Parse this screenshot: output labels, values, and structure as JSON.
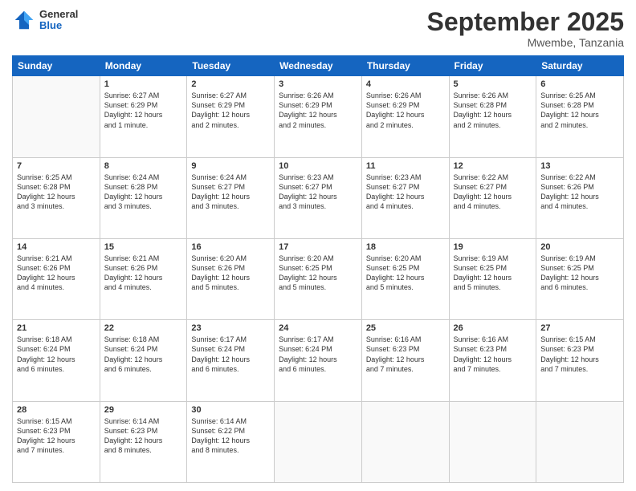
{
  "header": {
    "logo": {
      "general": "General",
      "blue": "Blue"
    },
    "title": "September 2025",
    "location": "Mwembe, Tanzania"
  },
  "weekdays": [
    "Sunday",
    "Monday",
    "Tuesday",
    "Wednesday",
    "Thursday",
    "Friday",
    "Saturday"
  ],
  "weeks": [
    [
      {
        "num": "",
        "info": ""
      },
      {
        "num": "1",
        "info": "Sunrise: 6:27 AM\nSunset: 6:29 PM\nDaylight: 12 hours\nand 1 minute."
      },
      {
        "num": "2",
        "info": "Sunrise: 6:27 AM\nSunset: 6:29 PM\nDaylight: 12 hours\nand 2 minutes."
      },
      {
        "num": "3",
        "info": "Sunrise: 6:26 AM\nSunset: 6:29 PM\nDaylight: 12 hours\nand 2 minutes."
      },
      {
        "num": "4",
        "info": "Sunrise: 6:26 AM\nSunset: 6:29 PM\nDaylight: 12 hours\nand 2 minutes."
      },
      {
        "num": "5",
        "info": "Sunrise: 6:26 AM\nSunset: 6:28 PM\nDaylight: 12 hours\nand 2 minutes."
      },
      {
        "num": "6",
        "info": "Sunrise: 6:25 AM\nSunset: 6:28 PM\nDaylight: 12 hours\nand 2 minutes."
      }
    ],
    [
      {
        "num": "7",
        "info": "Sunrise: 6:25 AM\nSunset: 6:28 PM\nDaylight: 12 hours\nand 3 minutes."
      },
      {
        "num": "8",
        "info": "Sunrise: 6:24 AM\nSunset: 6:28 PM\nDaylight: 12 hours\nand 3 minutes."
      },
      {
        "num": "9",
        "info": "Sunrise: 6:24 AM\nSunset: 6:27 PM\nDaylight: 12 hours\nand 3 minutes."
      },
      {
        "num": "10",
        "info": "Sunrise: 6:23 AM\nSunset: 6:27 PM\nDaylight: 12 hours\nand 3 minutes."
      },
      {
        "num": "11",
        "info": "Sunrise: 6:23 AM\nSunset: 6:27 PM\nDaylight: 12 hours\nand 4 minutes."
      },
      {
        "num": "12",
        "info": "Sunrise: 6:22 AM\nSunset: 6:27 PM\nDaylight: 12 hours\nand 4 minutes."
      },
      {
        "num": "13",
        "info": "Sunrise: 6:22 AM\nSunset: 6:26 PM\nDaylight: 12 hours\nand 4 minutes."
      }
    ],
    [
      {
        "num": "14",
        "info": "Sunrise: 6:21 AM\nSunset: 6:26 PM\nDaylight: 12 hours\nand 4 minutes."
      },
      {
        "num": "15",
        "info": "Sunrise: 6:21 AM\nSunset: 6:26 PM\nDaylight: 12 hours\nand 4 minutes."
      },
      {
        "num": "16",
        "info": "Sunrise: 6:20 AM\nSunset: 6:26 PM\nDaylight: 12 hours\nand 5 minutes."
      },
      {
        "num": "17",
        "info": "Sunrise: 6:20 AM\nSunset: 6:25 PM\nDaylight: 12 hours\nand 5 minutes."
      },
      {
        "num": "18",
        "info": "Sunrise: 6:20 AM\nSunset: 6:25 PM\nDaylight: 12 hours\nand 5 minutes."
      },
      {
        "num": "19",
        "info": "Sunrise: 6:19 AM\nSunset: 6:25 PM\nDaylight: 12 hours\nand 5 minutes."
      },
      {
        "num": "20",
        "info": "Sunrise: 6:19 AM\nSunset: 6:25 PM\nDaylight: 12 hours\nand 6 minutes."
      }
    ],
    [
      {
        "num": "21",
        "info": "Sunrise: 6:18 AM\nSunset: 6:24 PM\nDaylight: 12 hours\nand 6 minutes."
      },
      {
        "num": "22",
        "info": "Sunrise: 6:18 AM\nSunset: 6:24 PM\nDaylight: 12 hours\nand 6 minutes."
      },
      {
        "num": "23",
        "info": "Sunrise: 6:17 AM\nSunset: 6:24 PM\nDaylight: 12 hours\nand 6 minutes."
      },
      {
        "num": "24",
        "info": "Sunrise: 6:17 AM\nSunset: 6:24 PM\nDaylight: 12 hours\nand 6 minutes."
      },
      {
        "num": "25",
        "info": "Sunrise: 6:16 AM\nSunset: 6:23 PM\nDaylight: 12 hours\nand 7 minutes."
      },
      {
        "num": "26",
        "info": "Sunrise: 6:16 AM\nSunset: 6:23 PM\nDaylight: 12 hours\nand 7 minutes."
      },
      {
        "num": "27",
        "info": "Sunrise: 6:15 AM\nSunset: 6:23 PM\nDaylight: 12 hours\nand 7 minutes."
      }
    ],
    [
      {
        "num": "28",
        "info": "Sunrise: 6:15 AM\nSunset: 6:23 PM\nDaylight: 12 hours\nand 7 minutes."
      },
      {
        "num": "29",
        "info": "Sunrise: 6:14 AM\nSunset: 6:23 PM\nDaylight: 12 hours\nand 8 minutes."
      },
      {
        "num": "30",
        "info": "Sunrise: 6:14 AM\nSunset: 6:22 PM\nDaylight: 12 hours\nand 8 minutes."
      },
      {
        "num": "",
        "info": ""
      },
      {
        "num": "",
        "info": ""
      },
      {
        "num": "",
        "info": ""
      },
      {
        "num": "",
        "info": ""
      }
    ]
  ]
}
